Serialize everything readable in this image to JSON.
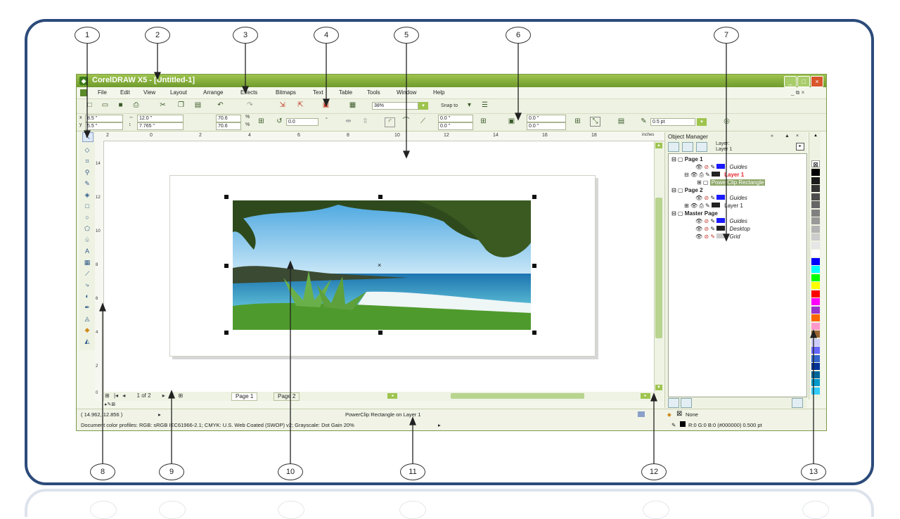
{
  "window": {
    "title": "CorelDRAW X5 - [Untitled-1]",
    "minimize": "_",
    "maximize": "□",
    "close": "×",
    "mdi_controls": "_ ⧉ ×"
  },
  "menu": [
    "File",
    "Edit",
    "View",
    "Layout",
    "Arrange",
    "Effects",
    "Bitmaps",
    "Text",
    "Table",
    "Tools",
    "Window",
    "Help"
  ],
  "standard_toolbar": {
    "zoom_value": "38%",
    "snap_to_label": "Snap to",
    "icons": [
      "new-icon",
      "open-icon",
      "save-icon",
      "print-icon",
      "cut-icon",
      "copy-icon",
      "paste-icon",
      "undo-icon",
      "redo-icon",
      "import-icon",
      "export-icon",
      "app-launcher-icon",
      "welcome-icon"
    ]
  },
  "property_bar": {
    "x": "8.5 \"",
    "y": "5.5 \"",
    "width": "12.0 \"",
    "height": "7.765 \"",
    "scale_w": "70.6",
    "scale_h": "70.6",
    "percent": "%",
    "rotation": "0.0",
    "degree": "°",
    "corner_tl": "0.0 \"",
    "corner_bl": "0.0 \"",
    "corner_tr": "0.0 \"",
    "corner_br": "0.0 \"",
    "outline_width": "0.5 pt"
  },
  "ruler": {
    "unit_label": "inches",
    "h_ticks": [
      "2",
      "0",
      "2",
      "4",
      "6",
      "8",
      "10",
      "12",
      "14",
      "16",
      "18"
    ],
    "v_ticks": [
      "14",
      "12",
      "10",
      "8",
      "6",
      "4",
      "2",
      "0"
    ]
  },
  "toolbox": [
    "pick-tool-icon",
    "shape-tool-icon",
    "crop-tool-icon",
    "zoom-tool-icon",
    "freehand-tool-icon",
    "smart-fill-tool-icon",
    "rectangle-tool-icon",
    "ellipse-tool-icon",
    "polygon-tool-icon",
    "basic-shapes-tool-icon",
    "text-tool-icon",
    "table-tool-icon",
    "dimension-tool-icon",
    "connector-tool-icon",
    "blend-tool-icon",
    "eyedropper-tool-icon",
    "outline-tool-icon",
    "fill-tool-icon",
    "interactive-fill-tool-icon"
  ],
  "document_navigator": {
    "page_counter": "1 of 2",
    "tabs": [
      "Page 1",
      "Page 2"
    ]
  },
  "status": {
    "coordinates": "( 14.962, 12.856 )",
    "object_info": "PowerClip Rectangle on Layer 1",
    "color_profiles": "Document color profiles: RGB: sRGB IEC61966-2.1; CMYK: U.S. Web Coated (SWOP) v2; Grayscale: Dot Gain 20%",
    "fill_label": "None",
    "outline_info": "R:0 G:0 B:0 (#000000)  0.500 pt"
  },
  "object_manager": {
    "title": "Object Manager",
    "layer_label": "Layer:",
    "current_layer": "Layer 1",
    "tree": [
      {
        "label": "Page 1",
        "type": "page"
      },
      {
        "label": "Guides",
        "type": "layer",
        "color": "#1a1aff"
      },
      {
        "label": "Layer 1",
        "type": "layer-active",
        "color": "#222222"
      },
      {
        "label": "PowerClip Rectangle",
        "type": "object"
      },
      {
        "label": "Page 2",
        "type": "page"
      },
      {
        "label": "Guides",
        "type": "layer",
        "color": "#1a1aff"
      },
      {
        "label": "Layer 1",
        "type": "layer",
        "color": "#222222"
      },
      {
        "label": "Master Page",
        "type": "page"
      },
      {
        "label": "Guides",
        "type": "layer",
        "color": "#1a1aff"
      },
      {
        "label": "Desktop",
        "type": "layer",
        "color": "#222222"
      },
      {
        "label": "Grid",
        "type": "layer",
        "color": "#cccccc"
      }
    ]
  },
  "palette_colors": [
    "#000000",
    "#1a1a1a",
    "#333333",
    "#4d4d4d",
    "#666666",
    "#808080",
    "#999999",
    "#b3b3b3",
    "#cccccc",
    "#e6e6e6",
    "#ffffff",
    "#0000ff",
    "#00ffff",
    "#00ff00",
    "#ffff00",
    "#ff0000",
    "#ff00ff",
    "#9933cc",
    "#ff6600",
    "#ff99cc",
    "#996633",
    "#ccccff",
    "#6666ff",
    "#3366cc",
    "#003399",
    "#006699",
    "#0099cc",
    "#33ccff"
  ],
  "callouts": [
    "1",
    "2",
    "3",
    "4",
    "5",
    "6",
    "7",
    "8",
    "9",
    "10",
    "11",
    "12",
    "13"
  ]
}
